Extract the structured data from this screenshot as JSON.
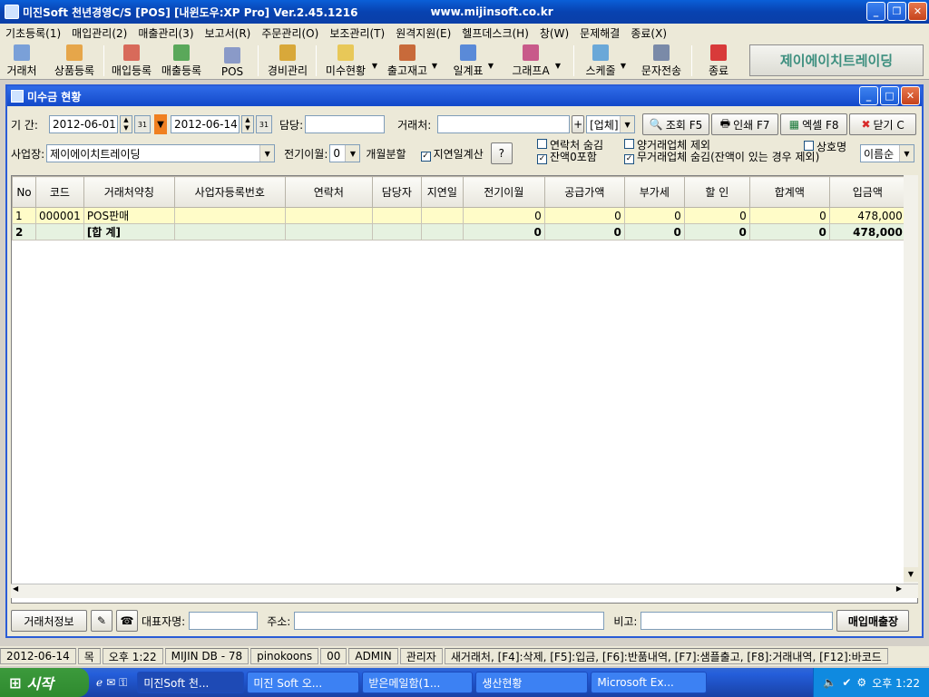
{
  "window": {
    "title": "미진Soft 천년경영C/S [POS] [내윈도우:XP Pro]  Ver.2.45.1216",
    "url": "www.mijinsoft.co.kr"
  },
  "menu": [
    "기초등록(1)",
    "매입관리(2)",
    "매출관리(3)",
    "보고서(R)",
    "주문관리(O)",
    "보조관리(T)",
    "원격지원(E)",
    "헬프데스크(H)",
    "창(W)",
    "문제해결",
    "종료(X)"
  ],
  "toolbar": [
    {
      "label": "거래처",
      "icon": "client-icon"
    },
    {
      "label": "상품등록",
      "icon": "product-icon"
    },
    {
      "label": "매입등록",
      "icon": "purchase-icon"
    },
    {
      "label": "매출등록",
      "icon": "sales-icon"
    },
    {
      "label": "POS",
      "icon": "pos-icon"
    },
    {
      "label": "경비관리",
      "icon": "expense-icon"
    },
    {
      "label": "미수현황",
      "icon": "receivable-icon"
    },
    {
      "label": "출고재고",
      "icon": "stock-icon"
    },
    {
      "label": "일계표",
      "icon": "daily-icon"
    },
    {
      "label": "그래프A",
      "icon": "chart-icon"
    },
    {
      "label": "스케줄",
      "icon": "calendar-icon"
    },
    {
      "label": "문자전송",
      "icon": "sms-icon"
    },
    {
      "label": "종료",
      "icon": "exit-icon"
    }
  ],
  "brand": "제이에이치트레이딩",
  "child": {
    "title": "미수금 현황"
  },
  "filters": {
    "period_label": "기 간:",
    "date_from": "2012-06-01",
    "date_to": "2012-06-14",
    "manager_label": "담당:",
    "manager_value": "",
    "client_label": "거래처:",
    "client_value": "",
    "client_type": "[업체]",
    "search_btn": "조회 F5",
    "print_btn": "인쇄 F7",
    "excel_btn": "엑셀 F8",
    "close_btn": "닫기 C",
    "biz_label": "사업장:",
    "biz_value": "제이에이치트레이딩",
    "carry_label": "전기이월:",
    "carry_value": "0",
    "month_split": "개월분할",
    "delay_calc": "지연일계산",
    "help_btn": "?",
    "hide_contact": "연락처 숨김",
    "zero_balance": "잔액0포함",
    "exclude_both": "양거래업체 제외",
    "hide_no_trade": "무거래업체 숨김(잔액이 있는 경우 제외)",
    "company_name": "상호명",
    "sort_value": "이름순"
  },
  "table": {
    "columns": [
      "No",
      "코드",
      "거래처약칭",
      "사업자등록번호",
      "연락처",
      "담당자",
      "지연일",
      "전기이월",
      "공급가액",
      "부가세",
      "할 인",
      "합계액",
      "입금액"
    ],
    "rows": [
      [
        "1",
        "000001",
        "POS판매",
        "",
        "",
        "",
        "",
        "0",
        "0",
        "0",
        "0",
        "0",
        "478,000"
      ],
      [
        "2",
        "",
        "[합 계]",
        "",
        "",
        "",
        "",
        "0",
        "0",
        "0",
        "0",
        "0",
        "478,000"
      ]
    ]
  },
  "bottom": {
    "client_info": "거래처정보",
    "rep_label": "대표자명:",
    "addr_label": "주소:",
    "memo_label": "비고:",
    "sales_btn": "매입매출장"
  },
  "status": [
    "2012-06-14",
    "목",
    "오후 1:22",
    "MIJIN DB - 78",
    "pinokoons",
    "00",
    "ADMIN",
    "관리자",
    "새거래처, [F4]:삭제, [F5]:입금, [F6]:반품내역, [F7]:샘플출고, [F8]:거래내역, [F12]:바코드"
  ],
  "taskbar": {
    "start": "시작",
    "tasks": [
      "미진Soft 천...",
      "미진 Soft 오...",
      "받은메일함(1...",
      "생산현황",
      "Microsoft Ex..."
    ],
    "clock": "오후 1:22"
  }
}
